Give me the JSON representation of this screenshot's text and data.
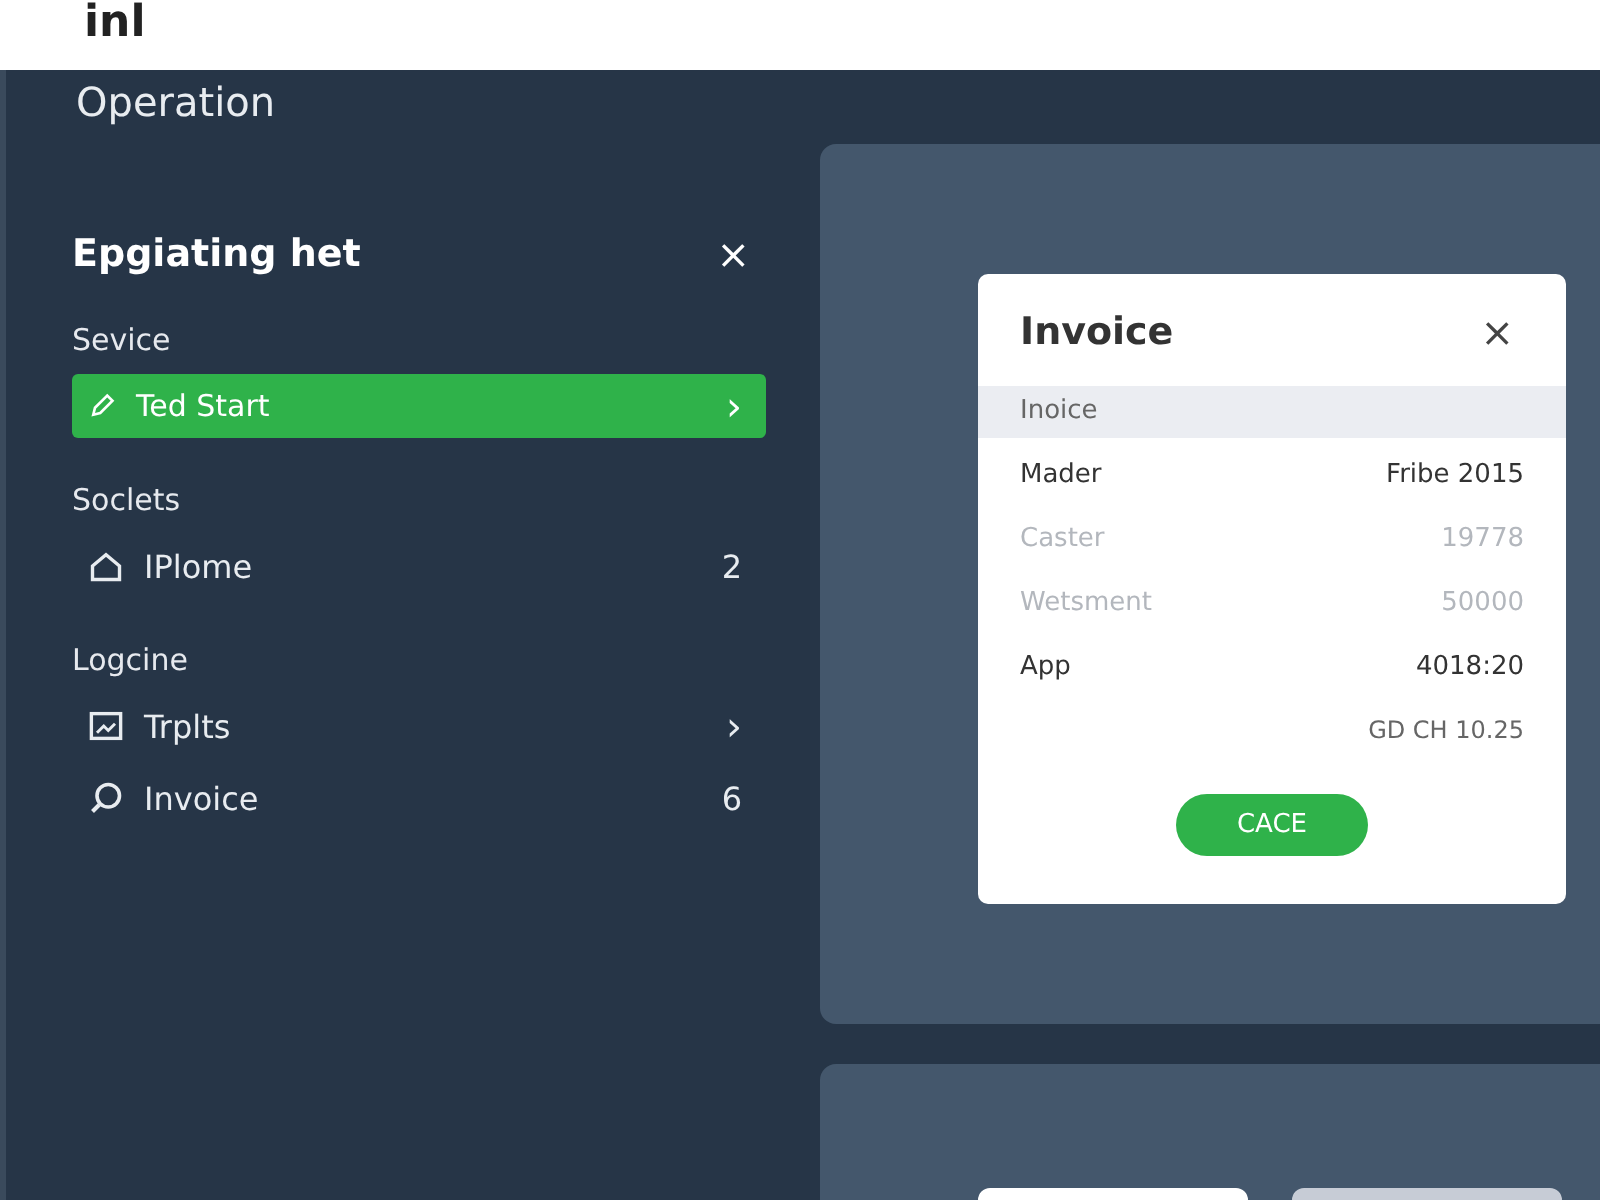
{
  "top_bar": {
    "logo": "inl"
  },
  "sidebar": {
    "title": "Operation",
    "heading": "Epgiating het",
    "close": "×",
    "sections": [
      {
        "label": "Sevice",
        "items": [
          {
            "label": "Ted Start",
            "trail": "›",
            "kind": "chevron",
            "selected": true
          }
        ]
      },
      {
        "label": "Soclets",
        "items": [
          {
            "label": "IPlome",
            "trail": "2",
            "kind": "count",
            "selected": false
          }
        ]
      },
      {
        "label": "Logcine",
        "items": [
          {
            "label": "Trplts",
            "trail": "›",
            "kind": "chevron",
            "selected": false
          },
          {
            "label": "Invoice",
            "trail": "6",
            "kind": "count",
            "selected": false
          }
        ]
      }
    ]
  },
  "dialog": {
    "title": "Invoice",
    "close": "×",
    "rows": [
      {
        "kind": "header",
        "label": "Inoice"
      },
      {
        "kind": "pair",
        "label": "Mader",
        "value": "Fribe 2015"
      },
      {
        "kind": "muted",
        "label": "Caster",
        "value": "19778"
      },
      {
        "kind": "muted",
        "label": "Wetsment",
        "value": "50000"
      },
      {
        "kind": "pair",
        "label": "App",
        "value": "4018:20"
      },
      {
        "kind": "value",
        "value": "GD CH 10.25"
      }
    ],
    "button": "CACE"
  }
}
